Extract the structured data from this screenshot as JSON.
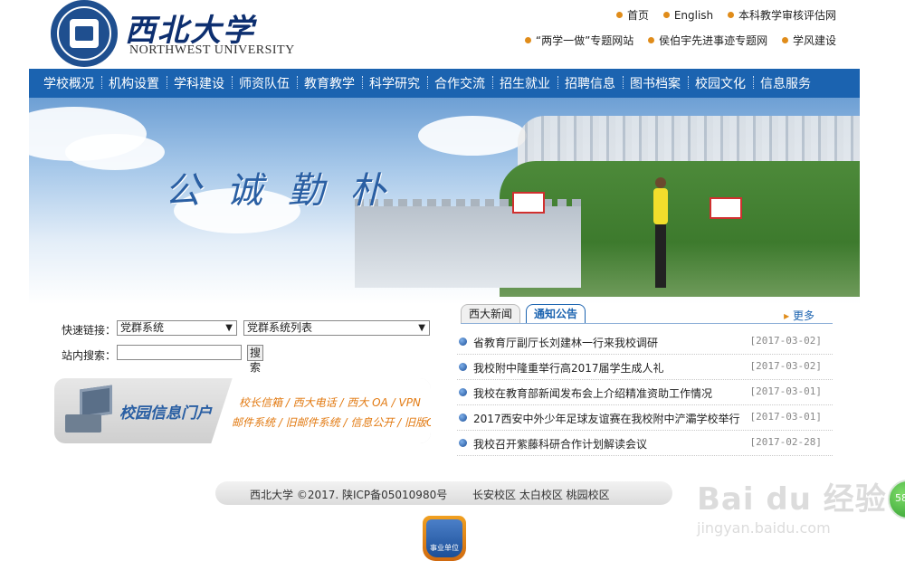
{
  "header": {
    "logo_cn": "西北大学",
    "logo_en": "NORTHWEST UNIVERSITY",
    "links_row1": [
      "首页",
      "English",
      "本科教学审核评估网"
    ],
    "links_row2": [
      "“两学一做”专题网站",
      "侯伯宇先进事迹专题网",
      "学风建设"
    ]
  },
  "nav": {
    "items": [
      "学校概况",
      "机构设置",
      "学科建设",
      "师资队伍",
      "教育教学",
      "科学研究",
      "合作交流",
      "招生就业",
      "招聘信息",
      "图书档案",
      "校园文化",
      "信息服务"
    ]
  },
  "banner": {
    "slogan": "公诚勤朴"
  },
  "quick": {
    "links_label": "快速链接：",
    "select1": "党群系统",
    "select2": "党群系统列表",
    "search_label": "站内搜索：",
    "search_value": "",
    "search_button": "搜索"
  },
  "portal": {
    "title": "校园信息门户",
    "links1": "校长信箱 / 西大电话 / 西大 OA / VPN",
    "links2": "邮件系统 / 旧邮件系统 / 信息公开 / 旧版OA"
  },
  "news": {
    "tabs": [
      "西大新闻",
      "通知公告"
    ],
    "more": "更多",
    "items": [
      {
        "title": "省教育厅副厅长刘建林一行来我校调研",
        "date": "[2017-03-02]"
      },
      {
        "title": "我校附中隆重举行高2017届学生成人礼",
        "date": "[2017-03-02]"
      },
      {
        "title": "我校在教育部新闻发布会上介绍精准资助工作情况",
        "date": "[2017-03-01]"
      },
      {
        "title": "2017西安中外少年足球友谊赛在我校附中浐灞学校举行",
        "date": "[2017-03-01]"
      },
      {
        "title": "我校召开紫藤科研合作计划解读会议",
        "date": "[2017-02-28]"
      }
    ]
  },
  "footer": {
    "copyright": "西北大学 ©2017. 陕ICP备05010980号",
    "campuses": "长安校区   太白校区   桃园校区",
    "badge": "事业单位"
  },
  "watermark": {
    "main": "Bai du 经验",
    "sub": "jingyan.baidu.com",
    "side": "58"
  },
  "colors": {
    "nav_bg": "#1b63b0",
    "accent": "#e08c1a",
    "portal_links": "#e27a12"
  }
}
